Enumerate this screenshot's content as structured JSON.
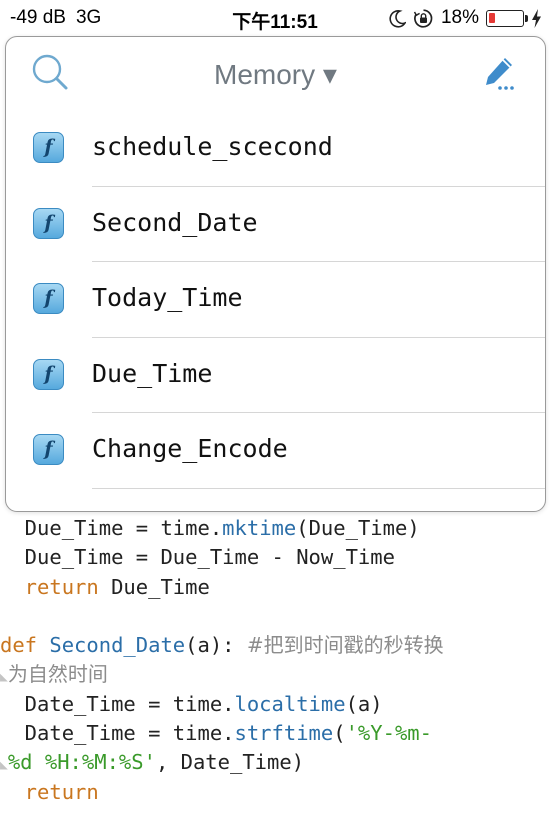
{
  "status_bar": {
    "signal": "-49 dB",
    "network": "3G",
    "time": "下午11:51",
    "battery_percent": "18%",
    "battery_level": 0.18,
    "icons": [
      "moon-icon",
      "rotation-lock-icon",
      "battery-icon",
      "charging-bolt-icon"
    ]
  },
  "popover": {
    "title": "Memory ▾",
    "search_icon": "search-icon",
    "edit_icon": "edit-pencil-icon",
    "item_icon_glyph": "f",
    "items": [
      {
        "label": "schedule_scecond"
      },
      {
        "label": "Second_Date"
      },
      {
        "label": "Today_Time"
      },
      {
        "label": "Due_Time"
      },
      {
        "label": "Change_Encode"
      }
    ]
  },
  "code": {
    "l1_a": "  Due_Time = time.",
    "l1_fn": "mktime",
    "l1_b": "(Due_Time)",
    "l2": "  Due_Time = Due_Time - Now_Time",
    "l3_kw": "  return",
    "l3_b": " Due_Time",
    "l5_kw": "def",
    "l5_fn": " Second_Date",
    "l5_b": "(a): ",
    "l5_cmt": "#把到时间戳的秒转换",
    "l6_cmt": "为自然时间",
    "l7_a": "  Date_Time = time.",
    "l7_fn": "localtime",
    "l7_b": "(a)",
    "l8_a": "  Date_Time = time.",
    "l8_fn": "strftime",
    "l8_b": "(",
    "l8_str": "'%Y-%m-",
    "l9_str": "%d %H:%M:%S'",
    "l9_b": ", Date_Time)",
    "l10_kw": "  return"
  },
  "colors": {
    "keyword": "#c9761f",
    "function": "#2b6ea8",
    "string": "#3a9a2a",
    "comment": "#8c8c8c",
    "icon_blue": "#56a9dd"
  }
}
